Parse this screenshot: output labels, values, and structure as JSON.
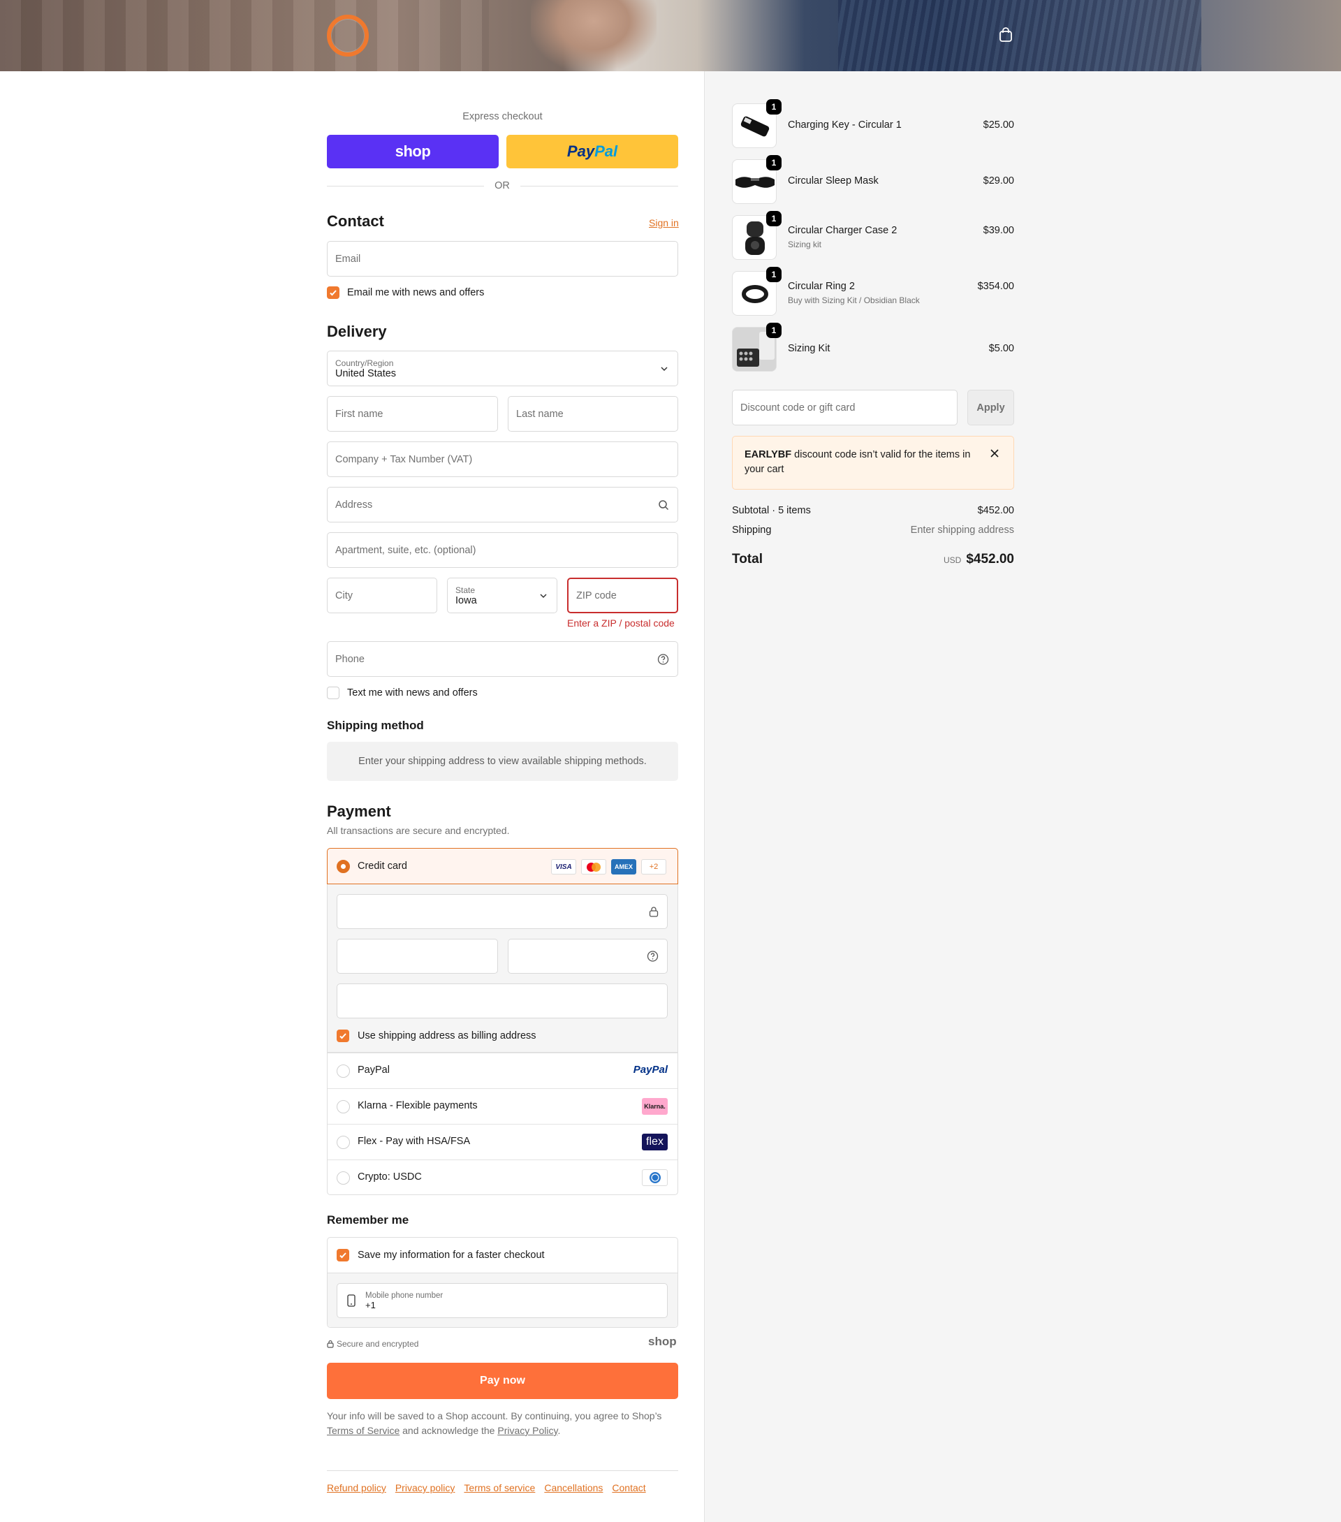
{
  "header": {
    "logo": "brand-logo",
    "cart_icon": "shopping-bag-icon"
  },
  "express": {
    "title": "Express checkout",
    "shop_label": "shop",
    "paypal_label_a": "Pay",
    "paypal_label_b": "Pal",
    "or_label": "OR"
  },
  "contact": {
    "heading": "Contact",
    "sign_in": "Sign in",
    "email_placeholder": "Email",
    "newsletter_label": "Email me with news and offers"
  },
  "delivery": {
    "heading": "Delivery",
    "country_label": "Country/Region",
    "country_value": "United States",
    "first_name": "First name",
    "last_name": "Last name",
    "company": "Company + Tax Number (VAT)",
    "address": "Address",
    "apartment": "Apartment, suite, etc. (optional)",
    "city": "City",
    "state_label": "State",
    "state_value": "Iowa",
    "zip": "ZIP code",
    "zip_error": "Enter a ZIP / postal code",
    "phone": "Phone",
    "text_opt_in": "Text me with news and offers"
  },
  "shipping_method": {
    "heading": "Shipping method",
    "info": "Enter your shipping address to view available shipping methods."
  },
  "payment": {
    "heading": "Payment",
    "subtitle": "All transactions are secure and encrypted.",
    "credit_card": "Credit card",
    "card_logos": [
      "VISA",
      "mastercard",
      "AMEX",
      "+2"
    ],
    "billing_same": "Use shipping address as billing address",
    "options": [
      {
        "label": "PayPal",
        "logo": "PayPal"
      },
      {
        "label": "Klarna - Flexible payments",
        "logo": "Klarna."
      },
      {
        "label": "Flex - Pay with HSA/FSA",
        "logo": "flex"
      },
      {
        "label": "Crypto: USDC",
        "logo": "usdc-icon"
      }
    ]
  },
  "remember": {
    "heading": "Remember me",
    "save_label": "Save my information for a faster checkout",
    "mobile_label": "Mobile phone number",
    "mobile_value": "+1",
    "secure_label": "Secure and encrypted",
    "shop_brand": "shop"
  },
  "pay_now": "Pay now",
  "legal": {
    "text_a": "Your info will be saved to a Shop account. By continuing, you agree to Shop’s",
    "terms": "Terms of Service",
    "text_b": "and acknowledge the",
    "privacy": "Privacy Policy",
    "text_c": "."
  },
  "footer_links": [
    "Refund policy",
    "Privacy policy",
    "Terms of service",
    "Cancellations",
    "Contact"
  ],
  "summary": {
    "items": [
      {
        "name": "Charging Key - Circular 1",
        "sub": "",
        "price": "$25.00",
        "qty": "1"
      },
      {
        "name": "Circular Sleep Mask",
        "sub": "",
        "price": "$29.00",
        "qty": "1"
      },
      {
        "name": "Circular Charger Case 2",
        "sub": "Sizing kit",
        "price": "$39.00",
        "qty": "1"
      },
      {
        "name": "Circular Ring 2",
        "sub": "Buy with Sizing Kit / Obsidian Black",
        "price": "$354.00",
        "qty": "1"
      },
      {
        "name": "Sizing Kit",
        "sub": "",
        "price": "$5.00",
        "qty": "1"
      }
    ],
    "discount_placeholder": "Discount code or gift card",
    "apply": "Apply",
    "notice_code": "EARLYBF",
    "notice_text": "discount code isn’t valid for the items in your cart",
    "subtotal_label": "Subtotal · 5 items",
    "subtotal_value": "$452.00",
    "shipping_label": "Shipping",
    "shipping_value": "Enter shipping address",
    "total_label": "Total",
    "currency": "USD",
    "total_value": "$452.00"
  },
  "colors": {
    "accent": "#e07121",
    "pay_button": "#fe703a",
    "shop_purple": "#5a31f4",
    "paypal_yellow": "#ffc439",
    "error": "#c82d2d"
  }
}
